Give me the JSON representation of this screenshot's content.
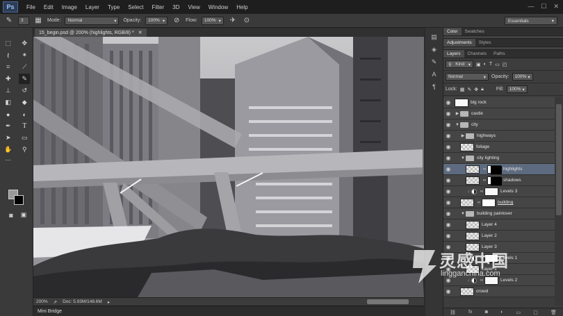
{
  "menu": [
    "File",
    "Edit",
    "Image",
    "Layer",
    "Type",
    "Select",
    "Filter",
    "3D",
    "View",
    "Window",
    "Help"
  ],
  "app_logo": "Ps",
  "options": {
    "brush_size": "3",
    "mode_label": "Mode:",
    "mode_value": "Normal",
    "opacity_label": "Opacity:",
    "opacity_value": "100%",
    "flow_label": "Flow:",
    "flow_value": "100%",
    "workspace": "Essentials"
  },
  "document": {
    "tab_title": "15_begin.psd @ 200% (highlights, RGB/8) *",
    "zoom": "200%",
    "doc_info": "Doc: 5.93M/148.6M"
  },
  "bottom_panel": "Mini Bridge",
  "panels": {
    "top_tabs": [
      "Color",
      "Swatches"
    ],
    "mid_tabs": [
      "Adjustments",
      "Styles"
    ],
    "layer_tabs": [
      "Layers",
      "Channels",
      "Paths"
    ],
    "kind_label": "Kind",
    "blend_mode": "Normal",
    "opacity_label": "Opacity:",
    "opacity_value": "100%",
    "lock_label": "Lock:",
    "fill_label": "Fill:",
    "fill_value": "100%"
  },
  "layers": [
    {
      "name": "big rock",
      "type": "layer",
      "indent": 0,
      "thumb": "white"
    },
    {
      "name": "castle",
      "type": "group",
      "indent": 0,
      "open": false
    },
    {
      "name": "city",
      "type": "group",
      "indent": 0,
      "open": true
    },
    {
      "name": "highways",
      "type": "group",
      "indent": 1,
      "open": false
    },
    {
      "name": "foliage",
      "type": "layer",
      "indent": 1,
      "thumb": "check"
    },
    {
      "name": "city lighting",
      "type": "group",
      "indent": 1,
      "open": true
    },
    {
      "name": "highlights",
      "type": "masked",
      "indent": 2,
      "selected": true
    },
    {
      "name": "shadows",
      "type": "masked",
      "indent": 2
    },
    {
      "name": "Levels 3",
      "type": "adjustment",
      "indent": 2
    },
    {
      "name": "building",
      "type": "masked-layer",
      "indent": 1
    },
    {
      "name": "building paintover",
      "type": "group",
      "indent": 1,
      "open": true
    },
    {
      "name": "Layer 4",
      "type": "layer",
      "indent": 2,
      "thumb": "check"
    },
    {
      "name": "Layer 2",
      "type": "layer",
      "indent": 2,
      "thumb": "check"
    },
    {
      "name": "Layer 3",
      "type": "layer",
      "indent": 2,
      "thumb": "check"
    },
    {
      "name": "Levels 1",
      "type": "adjustment",
      "indent": 2
    },
    {
      "name": "Layer 1",
      "type": "layer",
      "indent": 2,
      "thumb": "check"
    },
    {
      "name": "Levels 2",
      "type": "adjustment",
      "indent": 2
    },
    {
      "name": "crowd",
      "type": "layer",
      "indent": 1,
      "thumb": "check"
    }
  ],
  "watermark": {
    "cn": "灵感中国",
    "url": "lingganchina.com"
  },
  "colors": {
    "accent_selected": "#5d6a7f",
    "chrome_dark": "#1e1e1e",
    "panel": "#3d3d3d"
  }
}
